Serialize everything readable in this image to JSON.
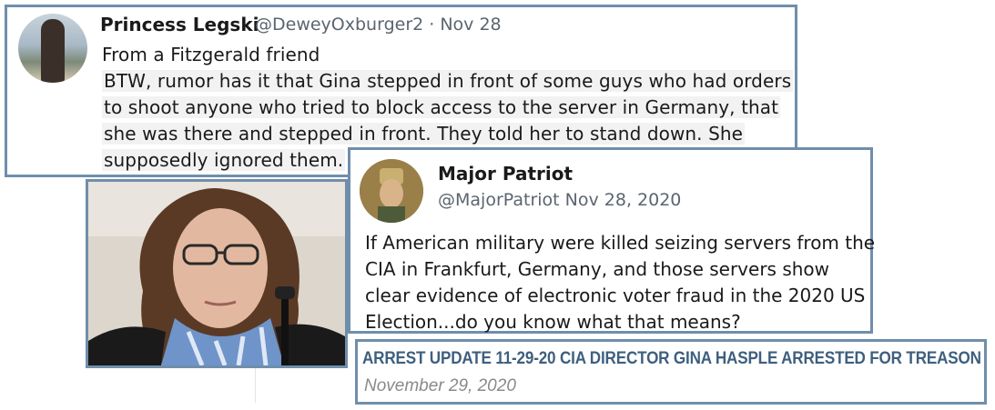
{
  "tweet1": {
    "display_name": "Princess Legski",
    "handle_date": "@DeweyOxburger2 · Nov 28",
    "lines": [
      "From a Fitzgerald friend",
      "BTW, rumor has it that Gina stepped in front of some guys who had orders",
      "to shoot anyone who tried to block  access to the server in Germany, that",
      "she was there and stepped in front. They told her to stand down. She",
      "supposedly ignored them."
    ]
  },
  "tweet2": {
    "display_name": "Major Patriot",
    "handle_date": "@MajorPatriot  Nov 28, 2020",
    "lines": [
      "If American military were killed seizing servers from the",
      "CIA in Frankfurt, Germany, and those servers show",
      "clear evidence of electronic voter fraud in the 2020 US",
      "Election...do you know what that means?"
    ]
  },
  "headline": {
    "title": "ARREST UPDATE 11-29-20 CIA DIRECTOR GINA HASPLE ARRESTED FOR TREASON",
    "date": "November 29, 2020"
  },
  "colors": {
    "border": "#6f8eab",
    "headline_text": "#3e5f7f",
    "meta_text": "#5b6570",
    "date_text": "#8a8a8a"
  }
}
